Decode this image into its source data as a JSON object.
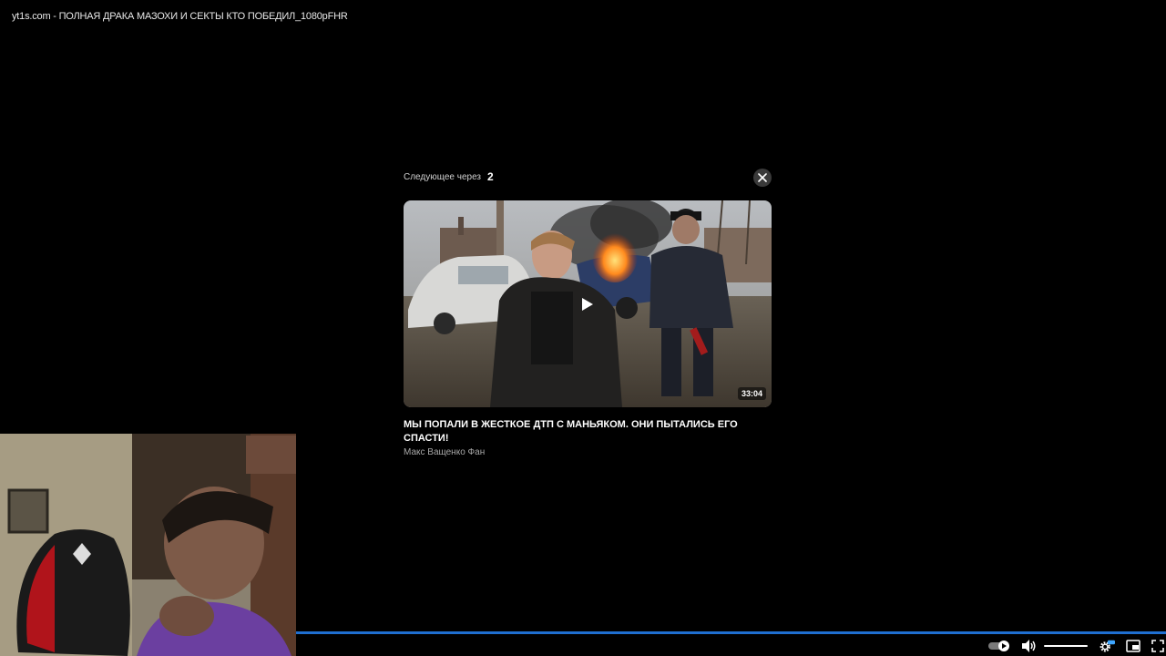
{
  "window": {
    "title": "yt1s.com - ПОЛНАЯ ДРАКА МАЗОХИ И СЕКТЫ КТО ПОБЕДИЛ_1080pFHR"
  },
  "up_next": {
    "label": "Следующее через",
    "countdown": "2",
    "duration": "33:04",
    "title": "МЫ ПОПАЛИ В ЖЕСТКОЕ ДТП С МАНЬЯКОМ. ОНИ ПЫТАЛИСЬ ЕГО СПАСТИ!",
    "channel": "Макс Ващенко Фан"
  },
  "player": {
    "progress_color": "#1f6fd1",
    "settings_badge": "HD",
    "volume_level": 1.0
  },
  "icons": [
    "close-icon",
    "play-icon",
    "autoplay-toggle-icon",
    "volume-icon",
    "settings-icon",
    "pip-icon",
    "fullscreen-icon"
  ]
}
